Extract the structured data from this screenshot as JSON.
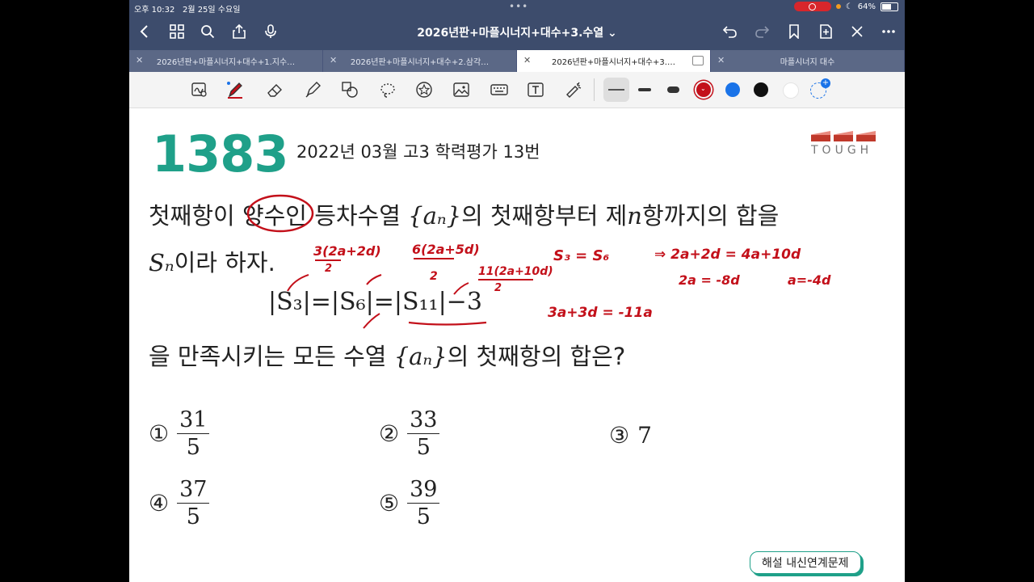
{
  "status_bar": {
    "time": "오후 10:32",
    "date": "2월 25일 수요일",
    "battery": "64%"
  },
  "nav": {
    "title": "2026년판+마플시너지+대수+3.수열 ⌄"
  },
  "tabs": [
    {
      "label": "2026년판+마플시너지+대수+1.지수…"
    },
    {
      "label": "2026년판+마플시너지+대수+2.삼각…"
    },
    {
      "label": "2026년판+마플시너지+대수+3.…"
    },
    {
      "label": "마플시너지 대수"
    }
  ],
  "toolbar": {
    "colors": {
      "red": "#c3101a",
      "blue": "#1a73e8",
      "black": "#111111",
      "white": "#ffffff"
    }
  },
  "problem": {
    "number": "1383",
    "source": "2022년 03월 고3 학력평가 13번",
    "difficulty": "TOUGH",
    "line1_a": "첫째항이 양수인 등차수열 ",
    "line1_b": "의 첫째항부터 제",
    "line1_c": "항까지의 합을",
    "an": "{aₙ}",
    "n": "n",
    "line2": "이라 하자.",
    "Sn": "Sₙ",
    "equation": "|S₃|=|S₆|=|S₁₁|−3",
    "line3_a": "을 만족시키는 모든 수열 ",
    "line3_b": "의 첫째항의 합은?",
    "choices": [
      {
        "mark": "①",
        "num": "31",
        "den": "5"
      },
      {
        "mark": "②",
        "num": "33",
        "den": "5"
      },
      {
        "mark": "③",
        "value": "7"
      },
      {
        "mark": "④",
        "num": "37",
        "den": "5"
      },
      {
        "mark": "⑤",
        "num": "39",
        "den": "5"
      }
    ],
    "solution_button": "해설 내신연계문제"
  },
  "annotations": {
    "a1": "3(2a+2d)",
    "a1_den": "2",
    "a2": "6(2a+5d)",
    "a2_den": "2",
    "a3": "11(2a+10d)",
    "a3_den": "2",
    "e1": "S₃ = S₆",
    "e2": "⇒ 2a+2d = 4a+10d",
    "e3": "2a = -8d",
    "e4": "a=-4d",
    "e5": "3a+3d = -11a"
  }
}
